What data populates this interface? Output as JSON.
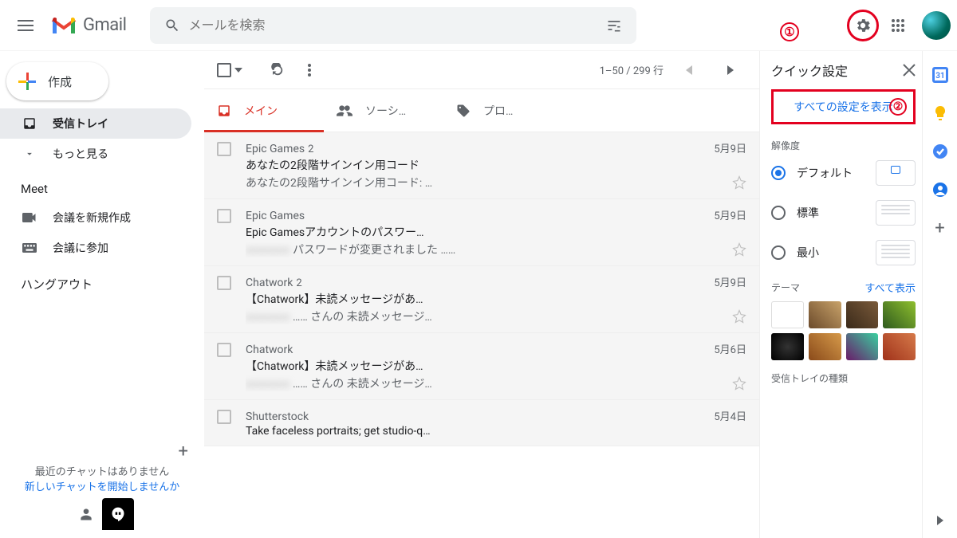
{
  "header": {
    "product_name": "Gmail",
    "search_placeholder": "メールを検索"
  },
  "annotations": {
    "one": "①",
    "two": "②"
  },
  "sidebar": {
    "compose": "作成",
    "inbox": "受信トレイ",
    "more": "もっと見る",
    "meet_title": "Meet",
    "meet_new": "会議を新規作成",
    "meet_join": "会議に参加",
    "hangouts_title": "ハングアウト",
    "no_recent_chat": "最近のチャットはありません",
    "start_chat_link": "新しいチャットを開始しませんか"
  },
  "toolbar": {
    "range": "1–50 / 299 行"
  },
  "tabs": {
    "main": "メイン",
    "social": "ソーシ…",
    "promo": "プロ…"
  },
  "emails": [
    {
      "sender": "Epic Games",
      "count": "2",
      "date": "5月9日",
      "subject": "あなたの2段階サインイン用コード",
      "snippet": "あなたの2段階サインイン用コード: …"
    },
    {
      "sender": "Epic Games",
      "count": "",
      "date": "5月9日",
      "subject": "Epic Gamesアカウントのパスワー…",
      "snippet": "パスワードが変更されました ……"
    },
    {
      "sender": "Chatwork",
      "count": "2",
      "date": "5月9日",
      "subject": "【Chatwork】未読メッセージがあ…",
      "snippet": "…… さんの 未読メッセージ…"
    },
    {
      "sender": "Chatwork",
      "count": "",
      "date": "5月6日",
      "subject": "【Chatwork】未読メッセージがあ…",
      "snippet": "…… さんの 未読メッセージ…"
    },
    {
      "sender": "Shutterstock",
      "count": "",
      "date": "5月4日",
      "subject": "Take faceless portraits; get studio-q…",
      "snippet": ""
    }
  ],
  "quick_settings": {
    "title": "クイック設定",
    "all_settings": "すべての設定を表示",
    "density_title": "解像度",
    "density": {
      "default": "デフォルト",
      "standard": "標準",
      "compact": "最小"
    },
    "theme_title": "テーマ",
    "theme_all": "すべて表示",
    "inbox_type_title": "受信トレイの種類"
  }
}
